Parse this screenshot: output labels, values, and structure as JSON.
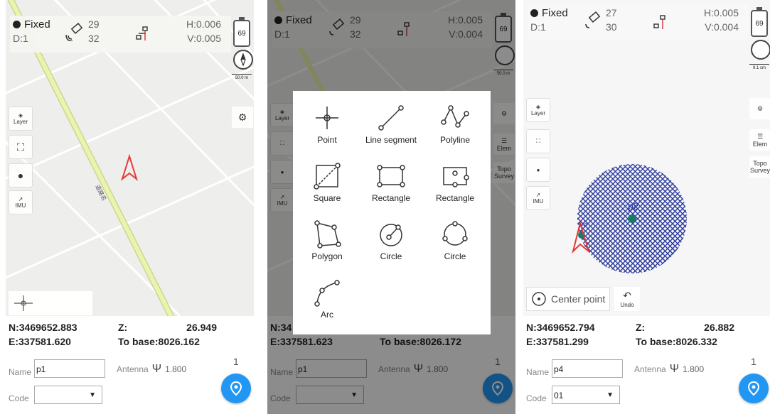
{
  "screens": [
    {
      "status": {
        "fix": "Fixed",
        "diff": "D:1",
        "sat_used": "29",
        "sat_visible": "32",
        "h": "H:0.006",
        "v": "V:0.005",
        "battery": "69",
        "scale": "50.0 m"
      },
      "left_buttons": {
        "layer": "Layer",
        "imu": "IMU"
      },
      "coords": {
        "n": "N:3469652.883",
        "e": "E:337581.620",
        "z_label": "Z:",
        "z_value": "26.949",
        "to_base": "To base:8026.162"
      },
      "form": {
        "name_label": "Name",
        "name_value": "p1",
        "antenna_label": "Antenna",
        "antenna_value": "1.800",
        "code_label": "Code",
        "code_value": "",
        "count": "1"
      },
      "road_label": "道路名"
    },
    {
      "status": {
        "fix": "Fixed",
        "diff": "D:1",
        "sat_used": "29",
        "sat_visible": "32",
        "h": "H:0.005",
        "v": "V:0.004",
        "battery": "69",
        "scale": "50.0 m"
      },
      "left_buttons": {
        "layer": "Layer",
        "imu": "IMU"
      },
      "right_buttons": {
        "elem": "Elem",
        "topo": "Topo",
        "survey": "Survey"
      },
      "coords": {
        "n": "N:34",
        "e": "E:337581.623",
        "to_base": "To base:8026.172"
      },
      "form": {
        "name_label": "Name",
        "name_value": "p1",
        "antenna_label": "Antenna",
        "antenna_value": "1.800",
        "code_label": "Code",
        "count": "1"
      },
      "dialog": {
        "items": [
          {
            "label": "Point",
            "icon": "point-icon"
          },
          {
            "label": "Line segment",
            "icon": "line-segment-icon"
          },
          {
            "label": "Polyline",
            "icon": "polyline-icon"
          },
          {
            "label": "Square",
            "icon": "square-icon"
          },
          {
            "label": "Rectangle",
            "icon": "rectangle-icon"
          },
          {
            "label": "Rectangle",
            "icon": "rectangle-center-icon"
          },
          {
            "label": "Polygon",
            "icon": "polygon-icon"
          },
          {
            "label": "Circle",
            "icon": "circle-center-icon"
          },
          {
            "label": "Circle",
            "icon": "circle-three-point-icon"
          },
          {
            "label": "Arc",
            "icon": "arc-icon"
          }
        ]
      }
    },
    {
      "status": {
        "fix": "Fixed",
        "diff": "D:1",
        "sat_used": "27",
        "sat_visible": "30",
        "h": "H:0.005",
        "v": "V:0.004",
        "battery": "69",
        "scale": "9.1 cm"
      },
      "left_buttons": {
        "layer": "Layer",
        "imu": "IMU"
      },
      "right_buttons": {
        "elem": "Elem",
        "topo": "Topo",
        "survey": "Survey"
      },
      "points": {
        "p2": "p2",
        "p3": "p3"
      },
      "actions": {
        "center_point": "Center point",
        "undo": "Undo"
      },
      "coords": {
        "n": "N:3469652.794",
        "e": "E:337581.299",
        "z_label": "Z:",
        "z_value": "26.882",
        "to_base": "To base:8026.332"
      },
      "form": {
        "name_label": "Name",
        "name_value": "p4",
        "antenna_label": "Antenna",
        "antenna_value": "1.800",
        "code_label": "Code",
        "code_value": "01",
        "count": "1"
      }
    }
  ]
}
